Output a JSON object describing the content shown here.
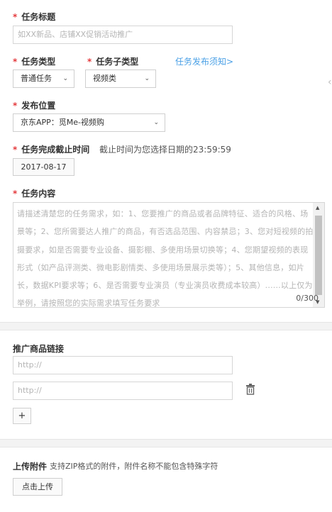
{
  "task_title": {
    "label": "任务标题",
    "placeholder": "如XX新品、店铺XX促销活动推广"
  },
  "task_type": {
    "label": "任务类型",
    "value": "普通任务"
  },
  "task_subtype": {
    "label": "任务子类型",
    "value": "视频类"
  },
  "publish_notice_link": "任务发布须知>",
  "publish_position": {
    "label": "发布位置",
    "value": "京东APP：觅Me-视频购"
  },
  "deadline": {
    "label": "任务完成截止时间",
    "hint": "截止时间为您选择日期的23:59:59",
    "date": "2017-08-17"
  },
  "task_content": {
    "label": "任务内容",
    "placeholder": "请描述清楚您的任务需求，如：1、您要推广的商品或者品牌特征、适合的风格、场景等；2、您所需要达人推广的商品，有否选品范围、内容禁忌；3、您对短视频的拍摄要求，如是否需要专业设备、摄影棚、多使用场景切换等；4、您期望视频的表现形式（如产品评测类、微电影剧情类、多使用场景展示类等）；5、其他信息，如片长，数据KPI要求等；6、是否需要专业演员（专业演员收费成本较高）......以上仅为举例，请按照您的实际需求填写任务要求",
    "counter": "0/300"
  },
  "promo_links": {
    "label": "推广商品链接",
    "placeholder_1": "http://",
    "placeholder_2": "http://",
    "add_label": "+"
  },
  "attachment": {
    "label": "上传附件",
    "hint": "支持ZIP格式的附件，附件名称不能包含特殊字符",
    "upload_label": "点击上传"
  },
  "colors": {
    "required": "#e4393c",
    "link": "#4aa0e6",
    "border": "#d6d6d6"
  },
  "icons": {
    "delete": "trash-icon",
    "dropdown": "chevron-down-icon",
    "scroll_right": "chevron-left-icon"
  }
}
